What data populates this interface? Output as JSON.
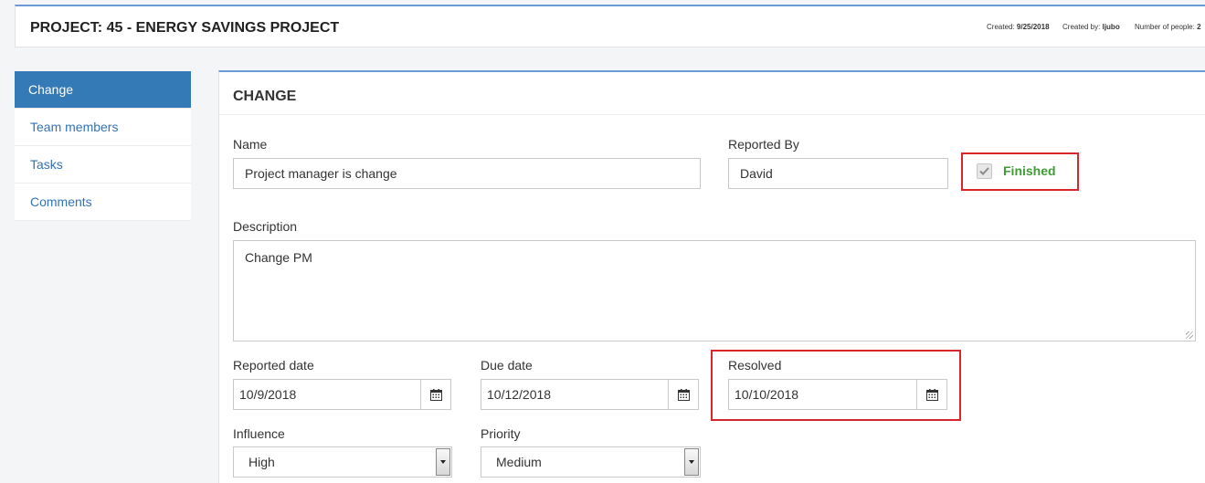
{
  "header": {
    "title": "PROJECT: 45 - ENERGY SAVINGS PROJECT",
    "created_label": "Created:",
    "created_value": "9/25/2018",
    "created_by_label": "Created by:",
    "created_by_value": "ljubo",
    "people_label": "Number of people:",
    "people_value": "2"
  },
  "sidebar": {
    "items": [
      {
        "label": "Change",
        "active": true
      },
      {
        "label": "Team members",
        "active": false
      },
      {
        "label": "Tasks",
        "active": false
      },
      {
        "label": "Comments",
        "active": false
      }
    ]
  },
  "panel": {
    "heading": "CHANGE",
    "name": {
      "label": "Name",
      "value": "Project manager is change"
    },
    "reported_by": {
      "label": "Reported By",
      "value": "David"
    },
    "finished": {
      "label": "Finished",
      "checked": true
    },
    "description": {
      "label": "Description",
      "value": "Change PM"
    },
    "reported_date": {
      "label": "Reported date",
      "value": "10/9/2018"
    },
    "due_date": {
      "label": "Due date",
      "value": "10/12/2018"
    },
    "resolved": {
      "label": "Resolved",
      "value": "10/10/2018"
    },
    "influence": {
      "label": "Influence",
      "value": "High"
    },
    "priority": {
      "label": "Priority",
      "value": "Medium"
    }
  },
  "icons": {
    "calendar": "calendar-icon",
    "checkmark": "checkmark-icon",
    "dropdown": "chevron-down-icon"
  },
  "colors": {
    "accent": "#337ab7",
    "link": "#3173b6",
    "highlight": "#d9262c",
    "finished": "#3f9c35"
  }
}
